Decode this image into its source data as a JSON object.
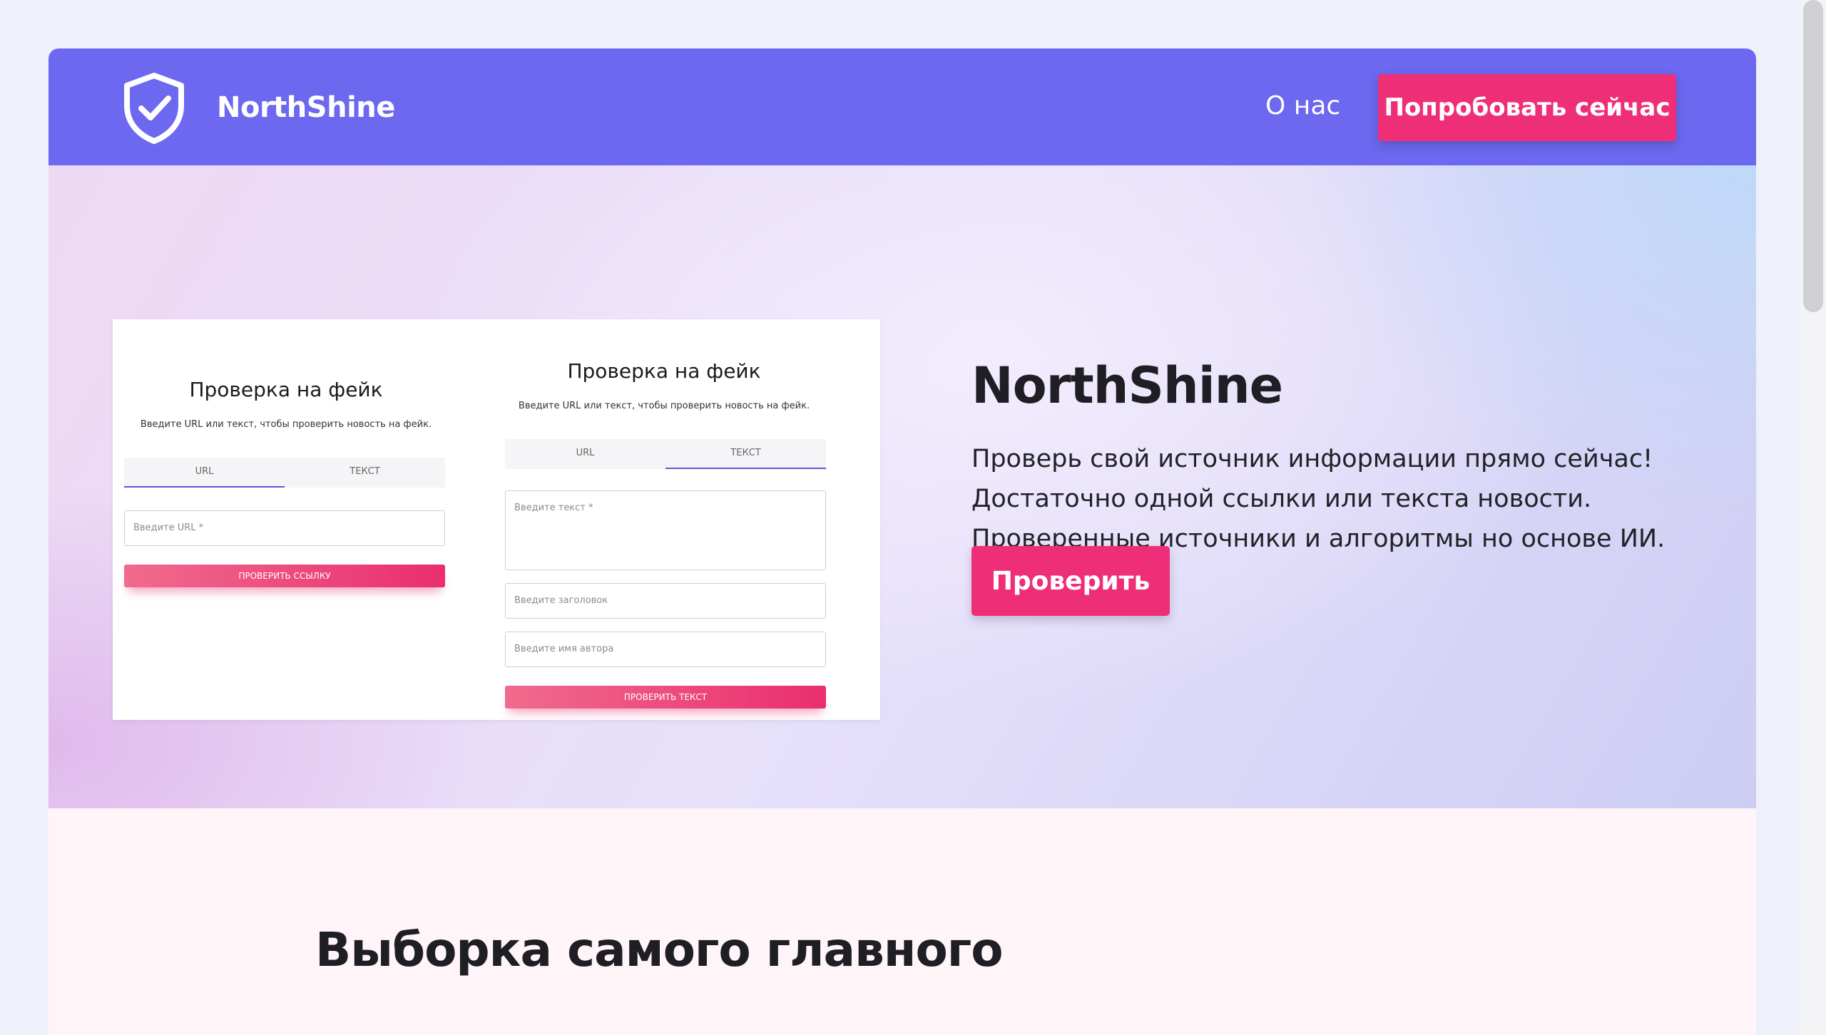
{
  "brand": {
    "name": "NorthShine",
    "logo_icon": "shield-check-icon"
  },
  "nav": {
    "about": "О нас",
    "try_now": "Попробовать сейчас"
  },
  "hero": {
    "title": "NorthShine",
    "lines": [
      "Проверь свой источник информации прямо сейчас!",
      "Достаточно одной ссылки или текста новости.",
      "Проверенные источники и алгоритмы но основе ИИ."
    ],
    "cta": "Проверить"
  },
  "preview": {
    "url_form": {
      "title": "Проверка на фейк",
      "subtitle": "Введите URL или текст, чтобы проверить новость на фейк.",
      "tabs": [
        "URL",
        "Текст"
      ],
      "active_tab": "URL",
      "url_placeholder": "Введите URL *",
      "submit": "Проверить ссылку"
    },
    "text_form": {
      "title": "Проверка на фейк",
      "subtitle": "Введите URL или текст, чтобы проверить новость на фейк.",
      "tabs": [
        "URL",
        "Текст"
      ],
      "active_tab": "Текст",
      "text_placeholder": "Введите текст *",
      "headline_placeholder": "Введите заголовок",
      "author_placeholder": "Введите имя автора",
      "submit": "Проверить текст"
    }
  },
  "section": {
    "heading": "Выборка самого главного"
  },
  "colors": {
    "navbar": "#6c68ef",
    "accent": "#ee2f77",
    "section_bg": "#fff5f8"
  }
}
